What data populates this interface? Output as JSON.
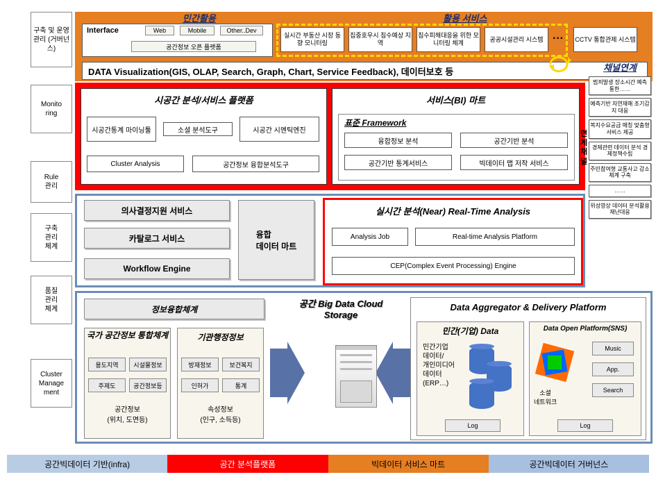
{
  "sidebar": {
    "items": [
      "구축 및 운영 관리 (거버넌스)",
      "Monito\nring",
      "Rule\n관리",
      "구축\n관리\n체계",
      "품질\n관리\n체계",
      "Cluster\nManage\nment"
    ]
  },
  "top": {
    "mingan_title": "민간활용",
    "hwalyong_title": "활용 서비스",
    "interface_label": "Interface",
    "web": "Web",
    "mobile": "Mobile",
    "other": "Other..Dev",
    "open_platform": "공간정보 오픈 플랫폼",
    "svc": [
      "실시간 부동산 시장 동향 모니터링",
      "집중호우시 침수예상 지역",
      "침수피해대응을 위한 모니터링 체계",
      "공공시설관리 시스템",
      "CCTV 통합관제 시스템"
    ],
    "ellipsis": "···",
    "viz_text": "DATA Visualization(GIS, OLAP, Search, Graph, Chart, Service Feedback), 데이터보호 등"
  },
  "red": {
    "left_title": "시공간 분석/서비스 플랫폼",
    "left_cells": [
      "시공간통계 마이닝툴",
      "소셜 분석도구",
      "시공간 시멘틱엔진",
      "Cluster Analysis",
      "공간정보 융합분석도구"
    ],
    "right_title": "서비스(BI) 마트",
    "framework_title": "표준 Framework",
    "right_cells": [
      "융합정보 분석",
      "공간기반 분석",
      "공간기반 통계서비스",
      "빅데이터 맵 저작 서비스"
    ]
  },
  "blue1": {
    "decision": "의사결정지원 서비스",
    "catalog": "카탈로그 서비스",
    "workflow": "Workflow Engine",
    "mart": "융합\n데이터 마트",
    "rt_title": "실시간 분석(Near) Real-Time Analysis",
    "rt_cells": [
      "Analysis Job",
      "Real-time Analysis Platform",
      "CEP(Complex Event Processing) Engine"
    ]
  },
  "blue2": {
    "info_title": "정보융합체계",
    "cloud_title": "공간 Big Data\nCloud Storage",
    "agg_title": "Data Aggregator & Delivery Platform",
    "nat_title": "국가 공간정보 통합체계",
    "nat_cells": [
      "용도지역",
      "시설물정보",
      "주제도",
      "공간정보등"
    ],
    "nat_sub": "공간정보\n(위치, 도면등)",
    "agency_title": "기관행정정보",
    "agency_cells": [
      "방재정보",
      "보건복지",
      "인허가",
      "통계"
    ],
    "agency_sub": "속성정보\n(인구, 소득등)",
    "private_title": "민간(기업) Data",
    "private_text": "민간기업\n데이터/\n개인미디어\n데이터\n(ERP…)",
    "log": "Log",
    "open_title": "Data Open Platform(SNS)",
    "music": "Music",
    "app": "App.",
    "search": "Search",
    "sns_label": "소셜\n네트워크"
  },
  "right": {
    "channel_title": "채널연계",
    "vert_label": "연계채널",
    "items": [
      "범죄발생 장소시간 예측 통한……",
      "예측기반 자연재해 조기감지 대응",
      "복지수요공급 매칭 맞춤형 서비스 제공",
      "경제관련 데이터 분석 경제정책수립",
      "주민참여형 교통사고 감소체계 구축",
      "……",
      "위성영상 데이터 분석활용 재난대응"
    ]
  },
  "legend": {
    "items": [
      "공간빅데이터 기반(infra)",
      "공간 분석플랫폼",
      "빅데이터 서비스 마트",
      "공간빅데이터 거버넌스"
    ]
  }
}
